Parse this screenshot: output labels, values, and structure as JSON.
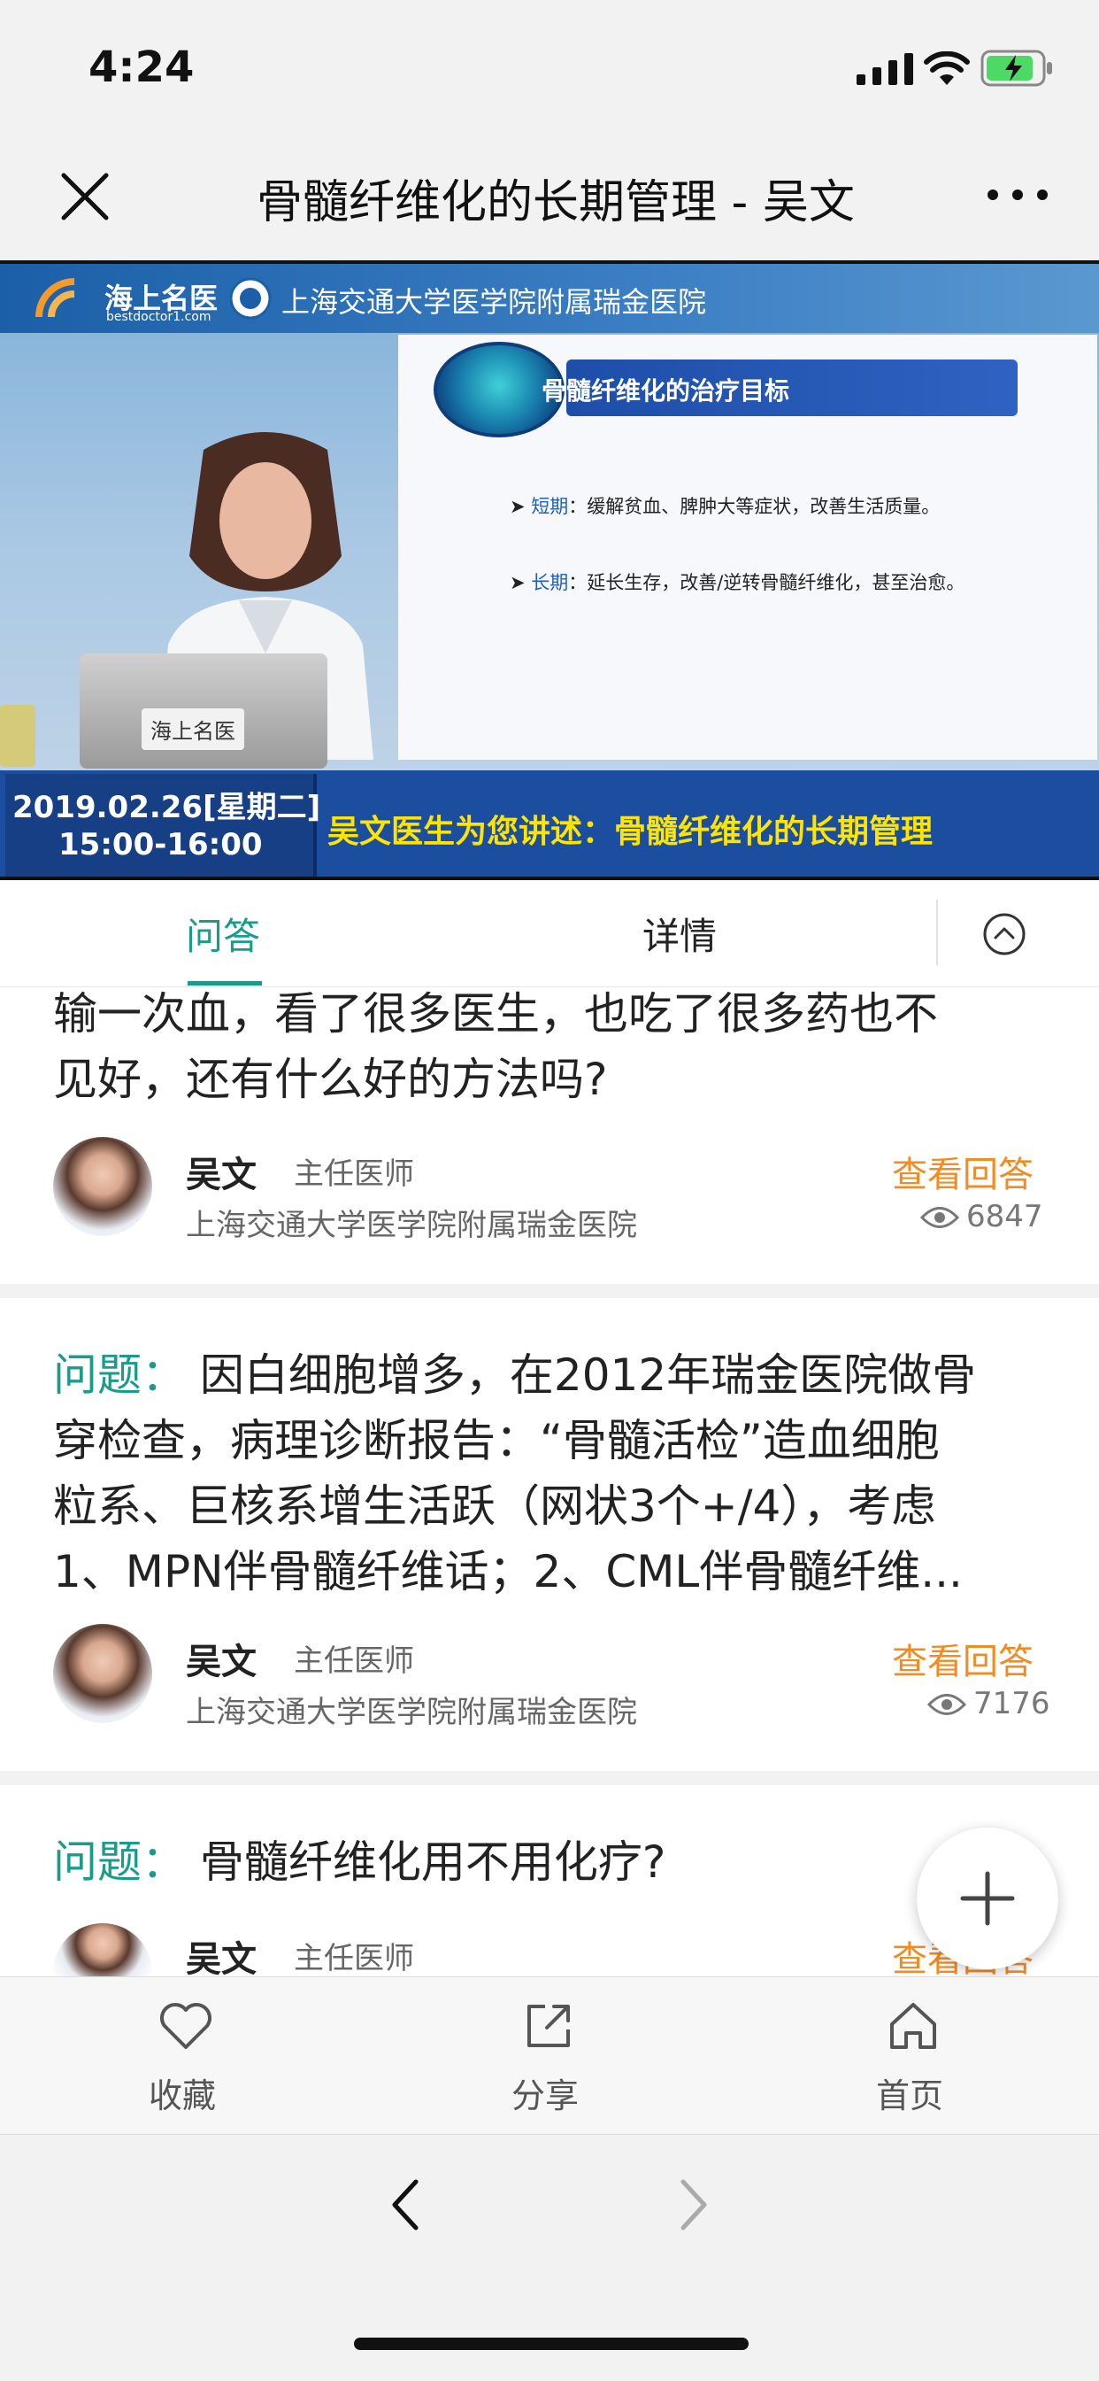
{
  "status": {
    "time": "4:24"
  },
  "nav": {
    "title": "骨髓纤维化的长期管理 - 吴文"
  },
  "video": {
    "logo_text": "海上名医",
    "logo_sub": "bestdoctor1.com",
    "hospital": "上海交通大学医学院附属瑞金医院",
    "slide_title": "骨髓纤维化的治疗目标",
    "slide_line1_key": "短期",
    "slide_line1_text": "：缓解贫血、脾肿大等症状，改善生活质量。",
    "slide_line2_key": "长期",
    "slide_line2_text": "：延长生存，改善/逆转骨髓纤维化，甚至治愈。",
    "laptop_logo": "海上名医",
    "date_line1": "2019.02.26[星期二]",
    "date_line2": "15:00-16:00",
    "caption": "吴文医生为您讲述：骨髓纤维化的长期管理"
  },
  "tabs": {
    "qa": "问答",
    "detail": "详情"
  },
  "questions": [
    {
      "lines": [
        "输一次血，看了很多医生，也吃了很多药也不",
        "见好，还有什么好的方法吗?"
      ],
      "doctor_name": "吴文",
      "doctor_title": "主任医师",
      "hospital": "上海交通大学医学院附属瑞金医院",
      "answer_label": "查看回答",
      "views": "6847"
    },
    {
      "label": "问题：",
      "lines": [
        "因白细胞增多，在2012年瑞金医院做骨",
        "穿检查，病理诊断报告：“骨髓活检”造血细胞",
        "粒系、巨核系增生活跃（网状3个+/4），考虑",
        "1、MPN伴骨髓纤维话；2、CML伴骨髓纤维..."
      ],
      "doctor_name": "吴文",
      "doctor_title": "主任医师",
      "hospital": "上海交通大学医学院附属瑞金医院",
      "answer_label": "查看回答",
      "views": "7176"
    },
    {
      "label": "问题：",
      "lines": [
        "骨髓纤维化用不用化疗?"
      ],
      "doctor_name": "吴文",
      "doctor_title": "主任医师",
      "answer_label": "查看回答"
    }
  ],
  "toolbar": {
    "favorite": "收藏",
    "share": "分享",
    "home": "首页"
  },
  "icons": {
    "close": "close-icon",
    "more": "more-icon",
    "collapse": "chevron-up-icon",
    "eye": "eye-icon",
    "add": "plus-icon",
    "heart": "heart-icon",
    "share": "share-icon",
    "home": "home-icon",
    "back": "back-icon",
    "forward": "forward-icon"
  },
  "colors": {
    "accent": "#1a9c8c",
    "answer": "#f08c22",
    "caption": "#ffe400"
  }
}
